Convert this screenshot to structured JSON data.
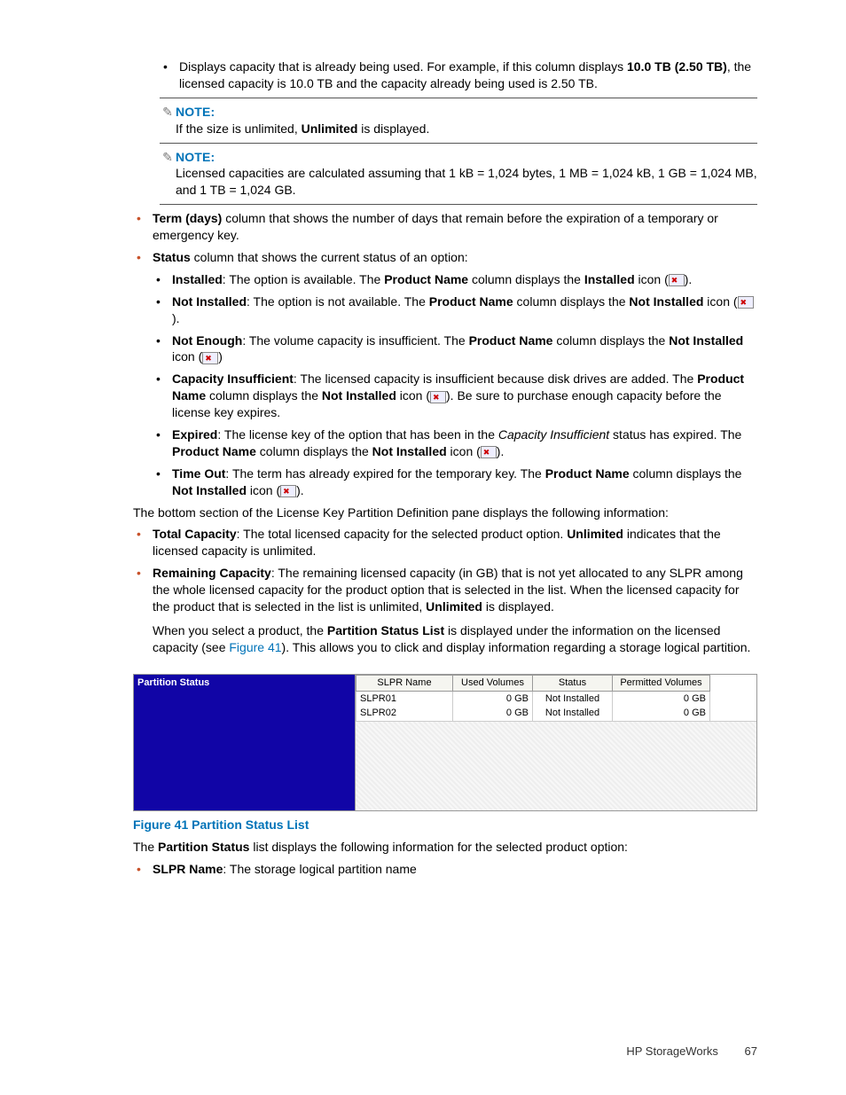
{
  "topBullet": {
    "prefix": "Displays capacity that is already being used. For example, if this column displays ",
    "bold1": "10.0 TB (2.50 TB)",
    "suffix": ", the licensed capacity is 10.0 TB and the capacity already being used is 2.50 TB."
  },
  "note1": {
    "label": "NOTE:",
    "body_pre": "If the size is unlimited, ",
    "body_bold": "Unlimited",
    "body_post": " is displayed."
  },
  "note2": {
    "label": "NOTE:",
    "body": "Licensed capacities are calculated assuming that 1 kB = 1,024 bytes, 1 MB = 1,024 kB, 1 GB = 1,024 MB, and 1 TB = 1,024 GB."
  },
  "termItem": {
    "bold": "Term (days)",
    "text": " column that shows the number of days that remain before the expiration of a temporary or emergency key."
  },
  "statusItem": {
    "bold": "Status",
    "text": " column that shows the current status of an option:"
  },
  "statusSub": {
    "installed": {
      "b1": "Installed",
      "t1": ": The option is available. The ",
      "b2": "Product Name",
      "t2": " column displays the ",
      "b3": "Installed",
      "t3": " icon (",
      "t4": ")."
    },
    "notInstalled": {
      "b1": "Not Installed",
      "t1": ": The option is not available. The ",
      "b2": "Product Name",
      "t2": " column displays the ",
      "b3": "Not Installed",
      "t3": " icon (",
      "t4": ")."
    },
    "notEnough": {
      "b1": "Not Enough",
      "t1": ": The volume capacity is insufficient. The ",
      "b2": "Product Name",
      "t2": " column displays the ",
      "b3": "Not Installed",
      "t3": " icon (",
      "t4": ")"
    },
    "capIns": {
      "b1": "Capacity Insufficient",
      "t1": ": The licensed capacity is insufficient because disk drives are added. The ",
      "b2": "Product Name",
      "t2": " column displays the ",
      "b3": "Not Installed",
      "t3": " icon (",
      "t4": "). Be sure to purchase enough capacity before the license key expires."
    },
    "expired": {
      "b1": "Expired",
      "t1": ": The license key of the option that has been in the ",
      "i1": "Capacity Insufficient",
      "t2": " status has expired. The ",
      "b2": "Product Name",
      "t3": " column displays the ",
      "b3": "Not Installed",
      "t4": " icon (",
      "t5": ")."
    },
    "timeOut": {
      "b1": "Time Out",
      "t1": ": The term has already expired for the temporary key. The ",
      "b2": "Product Name",
      "t2": " column displays the ",
      "b3": "Not Installed",
      "t3": " icon (",
      "t4": ")."
    }
  },
  "bottomPara": "The bottom section of the License Key Partition Definition pane displays the following information:",
  "totalCap": {
    "b1": "Total Capacity",
    "t1": ": The total licensed capacity for the selected product option. ",
    "b2": "Unlimited",
    "t2": " indicates that the licensed capacity is unlimited."
  },
  "remCap": {
    "b1": "Remaining Capacity",
    "t1": ": The remaining licensed capacity (in GB) that is not yet allocated to any SLPR among the whole licensed capacity for the product option that is selected in the list. When the licensed capacity for the product that is selected in the list is unlimited, ",
    "b2": "Unlimited",
    "t2": " is displayed."
  },
  "selectPara": {
    "t1": "When you select a product, the ",
    "b1": "Partition Status List",
    "t2": " is displayed under the information on the licensed capacity (see ",
    "link": "Figure 41",
    "t3": "). This allows you to click and display information regarding a storage logical partition."
  },
  "figure": {
    "sidebar": "Partition Status",
    "headers": [
      "SLPR Name",
      "Used Volumes",
      "Status",
      "Permitted Volumes"
    ],
    "rows": [
      {
        "name": "SLPR01",
        "used": "0 GB",
        "status": "Not Installed",
        "perm": "0 GB"
      },
      {
        "name": "SLPR02",
        "used": "0 GB",
        "status": "Not Installed",
        "perm": "0 GB"
      }
    ],
    "caption": "Figure 41 Partition Status List"
  },
  "afterFig": {
    "t1": "The ",
    "b1": "Partition Status",
    "t2": " list displays the following information for the selected product option:"
  },
  "slprItem": {
    "b1": "SLPR Name",
    "t1": ": The storage logical partition name"
  },
  "footer": {
    "brand": "HP StorageWorks",
    "page": "67"
  }
}
